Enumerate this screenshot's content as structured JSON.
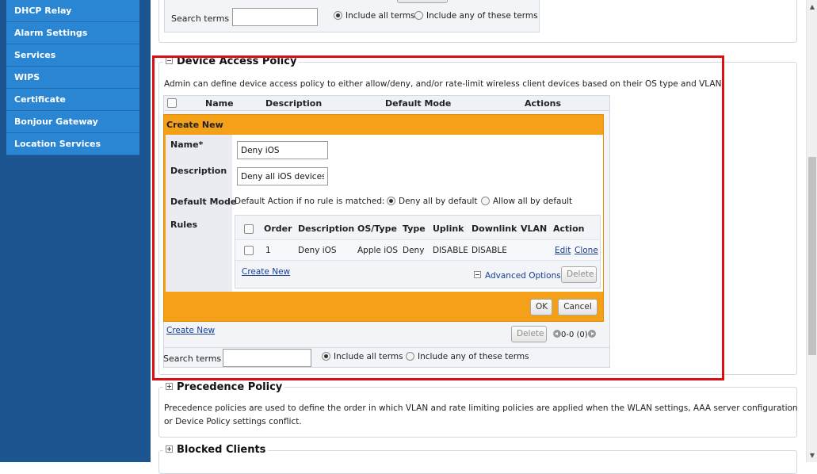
{
  "sidebar": {
    "items": [
      {
        "label": "DHCP Relay"
      },
      {
        "label": "Alarm Settings"
      },
      {
        "label": "Services"
      },
      {
        "label": "WIPS"
      },
      {
        "label": "Certificate"
      },
      {
        "label": "Bonjour Gateway"
      },
      {
        "label": "Location Services"
      }
    ]
  },
  "top_section": {
    "search_label": "Search terms",
    "search_value": "",
    "include_all_label": "Include all terms",
    "include_any_label": "Include any of these terms",
    "include_all_selected": true
  },
  "device_access_policy": {
    "title": "Device Access Policy",
    "description": "Admin can define device access policy to either allow/deny, and/or rate-limit wireless client devices based on their OS type and VLAN.",
    "table_headers": {
      "name": "Name",
      "description": "Description",
      "default_mode": "Default Mode",
      "actions": "Actions"
    },
    "create_panel": {
      "title": "Create New",
      "name_label": "Name*",
      "name_value": "Deny iOS",
      "description_label": "Description",
      "description_value": "Deny all iOS devices",
      "default_mode_label": "Default Mode",
      "default_action_text": "Default Action if no rule is matched:",
      "deny_all_label": "Deny all by default",
      "allow_all_label": "Allow all by default",
      "deny_selected": true,
      "rules_label": "Rules",
      "rules": {
        "headers": {
          "order": "Order",
          "description": "Description",
          "os_type": "OS/Type",
          "type": "Type",
          "uplink": "Uplink",
          "downlink": "Downlink",
          "vlan": "VLAN",
          "action": "Action"
        },
        "rows": [
          {
            "order": "1",
            "description": "Deny iOS",
            "os_type": "Apple iOS",
            "type": "Deny",
            "uplink": "DISABLE",
            "downlink": "DISABLE",
            "vlan": "",
            "edit": "Edit",
            "clone": "Clone"
          }
        ],
        "create_new": "Create New",
        "advanced_options": "Advanced Options",
        "delete": "Delete"
      },
      "ok": "OK",
      "cancel": "Cancel"
    },
    "create_new": "Create New",
    "delete": "Delete",
    "pager": "0-0 (0)",
    "search_label": "Search terms",
    "search_value": "",
    "include_all_label": "Include all terms",
    "include_any_label": "Include any of these terms",
    "include_all_selected": true
  },
  "precedence_policy": {
    "title": "Precedence Policy",
    "description_line1": "Precedence policies are used to define the order in which VLAN and rate limiting policies are applied when the WLAN settings, AAA server configuration",
    "description_line2": "or Device Policy settings conflict."
  },
  "blocked_clients": {
    "title": "Blocked Clients"
  },
  "colors": {
    "sidebar_bg": "#1c5590",
    "sidebar_item": "#2a86d3",
    "panel_orange": "#f4a018",
    "highlight_red": "#d90f14",
    "link_blue": "#163f92"
  }
}
